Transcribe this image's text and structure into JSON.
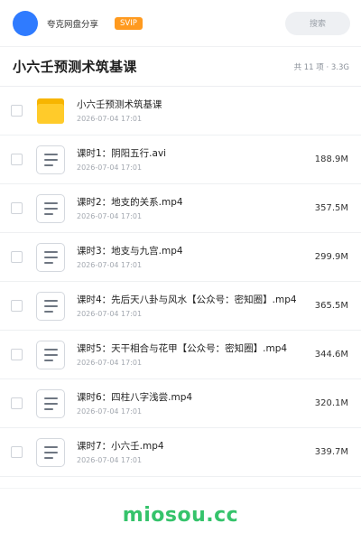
{
  "header": {
    "user_name": "夸克网盘分享",
    "badge": "SVIP",
    "search_placeholder": "搜索"
  },
  "folder": {
    "title": "小六壬预测术筑基课",
    "summary": "共 11 项 · 3.3G"
  },
  "files": [
    {
      "type": "folder",
      "name": "小六壬预测术筑基课",
      "date": "2026-07-04 17:01",
      "size": ""
    },
    {
      "type": "file",
      "name": "课时1：阴阳五行.avi",
      "date": "2026-07-04 17:01",
      "size": "188.9M"
    },
    {
      "type": "file",
      "name": "课时2：地支的关系.mp4",
      "date": "2026-07-04 17:01",
      "size": "357.5M"
    },
    {
      "type": "file",
      "name": "课时3：地支与九宫.mp4",
      "date": "2026-07-04 17:01",
      "size": "299.9M"
    },
    {
      "type": "file",
      "name": "课时4：先后天八卦与风水【公众号：密知圈】.mp4",
      "date": "2026-07-04 17:01",
      "size": "365.5M"
    },
    {
      "type": "file",
      "name": "课时5：天干相合与花甲【公众号：密知圈】.mp4",
      "date": "2026-07-04 17:01",
      "size": "344.6M"
    },
    {
      "type": "file",
      "name": "课时6：四柱八字浅尝.mp4",
      "date": "2026-07-04 17:01",
      "size": "320.1M"
    },
    {
      "type": "file",
      "name": "课时7：小六壬.mp4",
      "date": "2026-07-04 17:01",
      "size": "339.7M"
    }
  ],
  "footer": {
    "watermark": "miosou.cc"
  },
  "colors": {
    "avatar": "#2f7bff",
    "badge": "#ff9a1f",
    "folder": "#ffcb2a",
    "watermark": "#35c36b"
  },
  "icons": {
    "folder": "folder-icon",
    "file": "document-icon"
  }
}
